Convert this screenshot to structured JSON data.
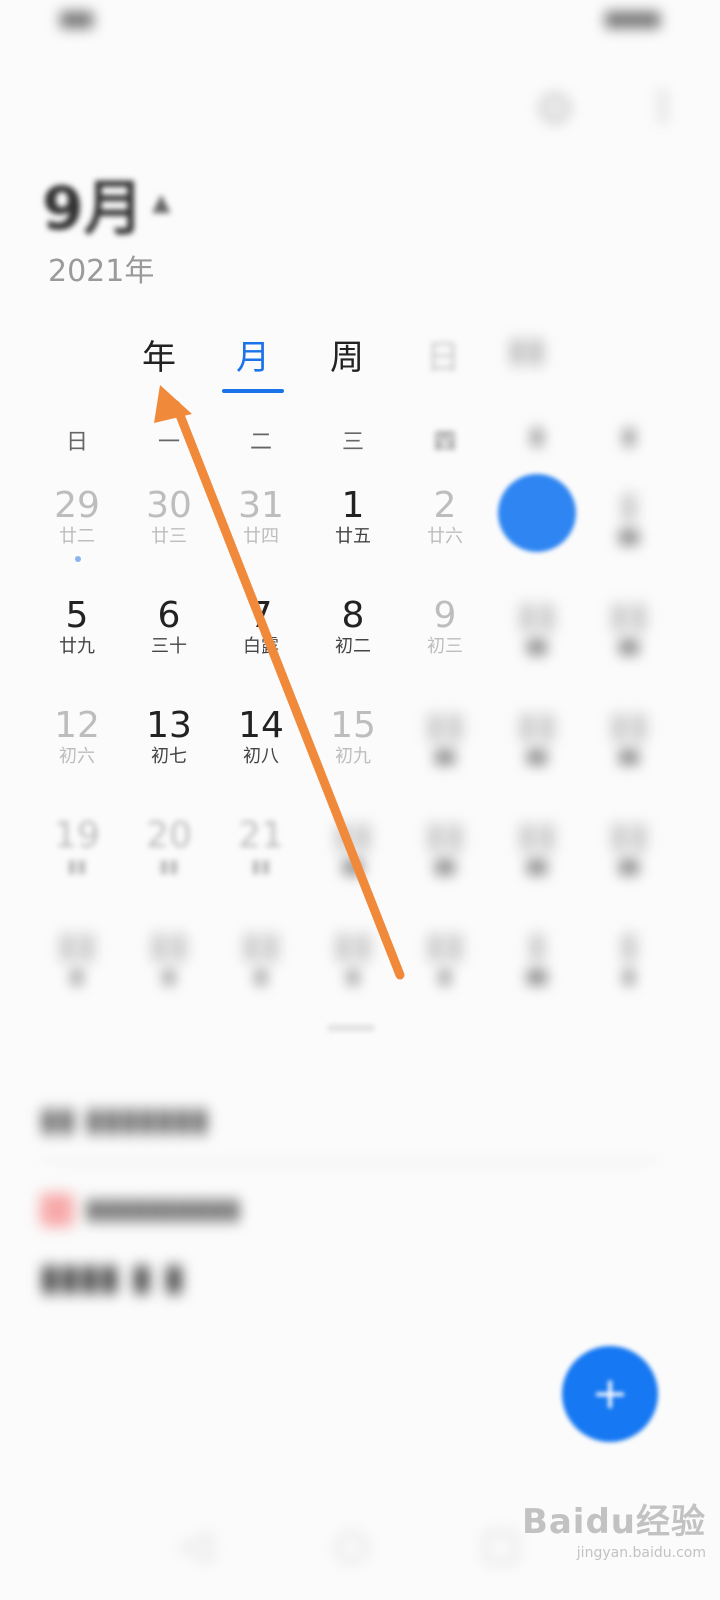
{
  "header": {
    "month": "9月",
    "year": "2021年"
  },
  "tabs": [
    {
      "label": "年"
    },
    {
      "label": "月",
      "active": true
    },
    {
      "label": "周"
    },
    {
      "label": "日"
    }
  ],
  "weekdays": [
    "日",
    "一",
    "二",
    "三",
    "四"
  ],
  "grid": {
    "rows": [
      [
        {
          "d": "29",
          "l": "廿二",
          "dim": true
        },
        {
          "d": "30",
          "l": "廿三",
          "dim": true
        },
        {
          "d": "31",
          "l": "廿四",
          "dim": true
        },
        {
          "d": "1",
          "l": "廿五"
        },
        {
          "d": "2",
          "l": "廿六",
          "dim": true
        }
      ],
      [
        {
          "d": "5",
          "l": "廿九"
        },
        {
          "d": "6",
          "l": "三十"
        },
        {
          "d": "7",
          "l": "白露"
        },
        {
          "d": "8",
          "l": "初二"
        },
        {
          "d": "9",
          "l": "初三",
          "dim": true
        }
      ],
      [
        {
          "d": "12",
          "l": "初六",
          "dim": true
        },
        {
          "d": "13",
          "l": "初七"
        },
        {
          "d": "14",
          "l": "初八"
        },
        {
          "d": "15",
          "l": "初九",
          "dim": true
        }
      ],
      [
        {
          "d": "19",
          "l": "",
          "dim": true
        },
        {
          "d": "20",
          "l": "",
          "dim": true
        },
        {
          "d": "21",
          "l": "",
          "dim": true
        }
      ]
    ]
  },
  "watermark": {
    "brand": "Baidu经验",
    "url": "jingyan.baidu.com"
  },
  "colors": {
    "accent": "#1a73e8",
    "arrow": "#f08a3a",
    "fab": "#1678f2"
  }
}
